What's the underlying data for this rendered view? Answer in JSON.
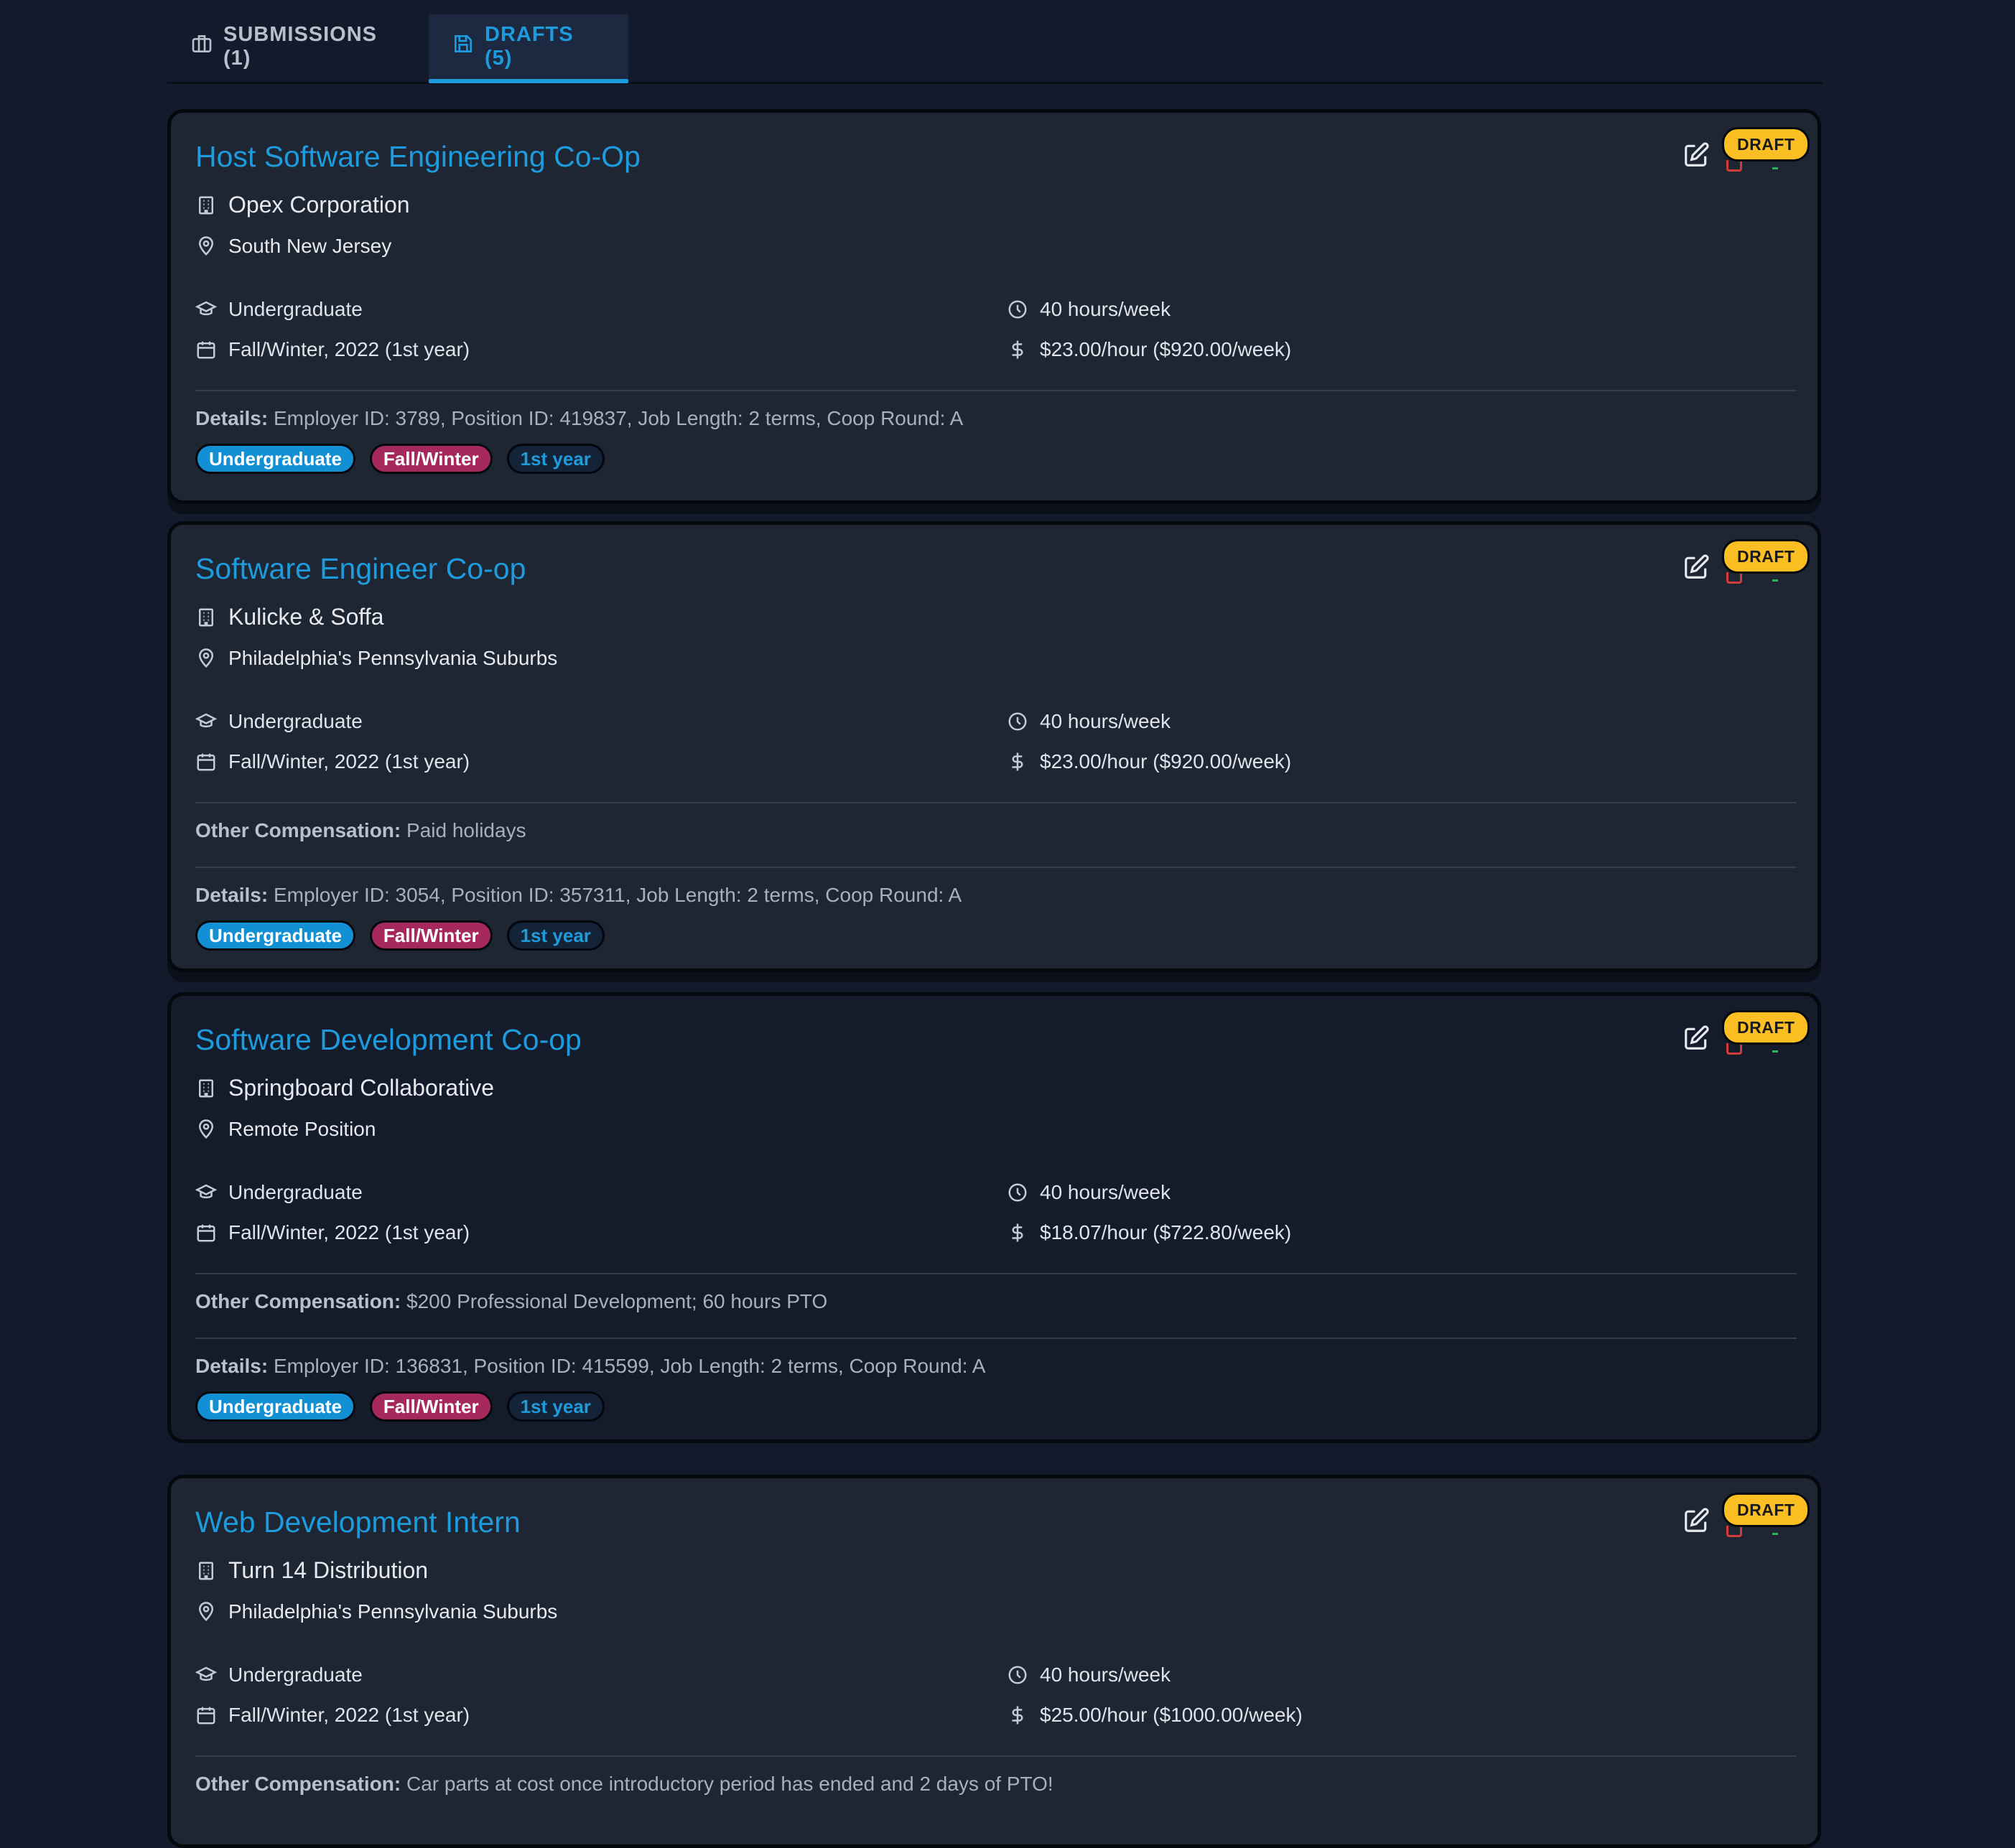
{
  "tabs": {
    "submissions_label": "SUBMISSIONS (1)",
    "drafts_label": "DRAFTS (5)"
  },
  "colors": {
    "accent": "#1d9bdc",
    "draft_badge": "#fbbf24",
    "tag_level": "#1290d4",
    "tag_term": "#a6295e"
  },
  "cards": [
    {
      "title": "Host Software Engineering Co-Op",
      "company": "Opex Corporation",
      "location": "South New Jersey",
      "level": "Undergraduate",
      "term": "Fall/Winter, 2022 (1st year)",
      "hours": "40 hours/week",
      "pay": "$23.00/hour ($920.00/week)",
      "details_label": "Details:",
      "details": "Employer ID: 3789, Position ID: 419837, Job Length: 2 terms, Coop Round: A",
      "tags": [
        "Undergraduate",
        "Fall/Winter",
        "1st year"
      ],
      "badge": "DRAFT"
    },
    {
      "title": "Software Engineer Co-op",
      "company": "Kulicke & Soffa",
      "location": "Philadelphia's Pennsylvania Suburbs",
      "level": "Undergraduate",
      "term": "Fall/Winter, 2022 (1st year)",
      "hours": "40 hours/week",
      "pay": "$23.00/hour ($920.00/week)",
      "other_label": "Other Compensation:",
      "other": "Paid holidays",
      "details_label": "Details:",
      "details": "Employer ID: 3054, Position ID: 357311, Job Length: 2 terms, Coop Round: A",
      "tags": [
        "Undergraduate",
        "Fall/Winter",
        "1st year"
      ],
      "badge": "DRAFT"
    },
    {
      "title": "Software Development Co-op",
      "company": "Springboard Collaborative",
      "location": "Remote Position",
      "level": "Undergraduate",
      "term": "Fall/Winter, 2022 (1st year)",
      "hours": "40 hours/week",
      "pay": "$18.07/hour ($722.80/week)",
      "other_label": "Other Compensation:",
      "other": "$200 Professional Development; 60 hours PTO",
      "details_label": "Details:",
      "details": "Employer ID: 136831, Position ID: 415599, Job Length: 2 terms, Coop Round: A",
      "tags": [
        "Undergraduate",
        "Fall/Winter",
        "1st year"
      ],
      "badge": "DRAFT"
    },
    {
      "title": "Web Development Intern",
      "company": "Turn 14 Distribution",
      "location": "Philadelphia's Pennsylvania Suburbs",
      "level": "Undergraduate",
      "term": "Fall/Winter, 2022 (1st year)",
      "hours": "40 hours/week",
      "pay": "$25.00/hour ($1000.00/week)",
      "other_label": "Other Compensation:",
      "other": "Car parts at cost once introductory period has ended and 2 days of PTO!",
      "badge": "DRAFT"
    }
  ]
}
